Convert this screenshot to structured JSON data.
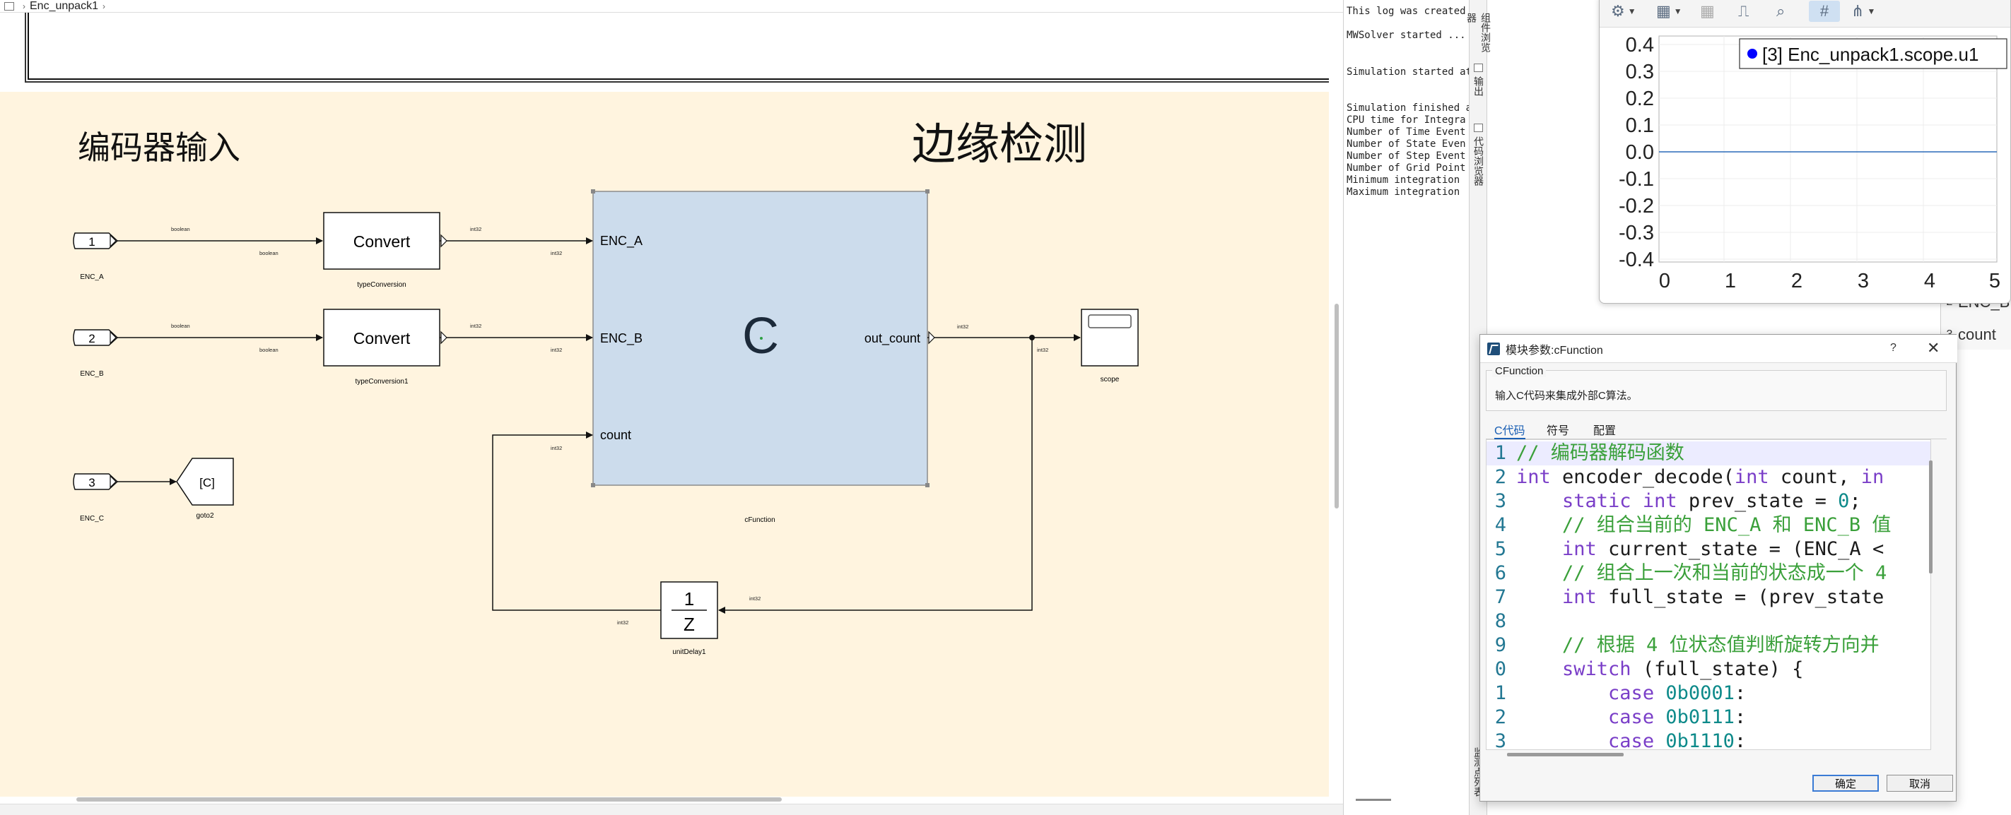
{
  "breadcrumb": {
    "model": "Enc_unpack1"
  },
  "diagram": {
    "areas": {
      "input_title": "编码器输入",
      "edge_title": "边缘检测"
    },
    "inports": [
      {
        "number": "1",
        "name": "ENC_A"
      },
      {
        "number": "2",
        "name": "ENC_B"
      },
      {
        "number": "3",
        "name": "ENC_C"
      }
    ],
    "converts": [
      {
        "label": "Convert",
        "name": "typeConversion"
      },
      {
        "label": "Convert",
        "name": "typeConversion1"
      }
    ],
    "goto": {
      "tag": "[C]",
      "name": "goto2"
    },
    "cfunction": {
      "symbol": "C",
      "name": "cFunction",
      "ports_in": [
        "ENC_A",
        "ENC_B",
        "count"
      ],
      "port_out": "out_count"
    },
    "scope": {
      "name": "scope"
    },
    "delay": {
      "numerator": "1",
      "denominator": "Z",
      "name": "unitDelay1"
    },
    "signal_types": {
      "bool": "boolean",
      "int": "int32"
    }
  },
  "log": {
    "lines": [
      "This log was created b",
      "MWSolver started ...",
      "Simulation started at",
      "Simulation finished at",
      "  CPU time for Integra",
      "  Number of Time Event",
      "  Number of State Even",
      "  Number of Step Event",
      "  Number of Grid Point",
      "  Minimum integration",
      "  Maximum integration"
    ]
  },
  "side_tabs": [
    "组件浏览器",
    "输出",
    "代码浏览器",
    "监测点列表"
  ],
  "scope_window": {
    "legend": "[3] Enc_unpack1.scope.u1",
    "legend_color": "#0000ff",
    "series_color": "#2a6ab8",
    "y_ticks": [
      "0.4",
      "0.3",
      "0.2",
      "0.1",
      "0.0",
      "-0.1",
      "-0.2",
      "-0.3",
      "-0.4"
    ],
    "x_ticks": [
      "0",
      "1",
      "2",
      "3",
      "4",
      "5"
    ]
  },
  "right_strip": {
    "rows": [
      {
        "num": "2",
        "text": "ENC_B"
      },
      {
        "num": "3",
        "text": "count"
      }
    ]
  },
  "dialog": {
    "title": "模块参数:cFunction",
    "help": "?",
    "close": "✕",
    "group_label": "CFunction",
    "group_desc": "输入C代码来集成外部C算法。",
    "tabs": [
      "C代码",
      "符号",
      "配置"
    ],
    "code": [
      {
        "n": "1",
        "tokens": [
          {
            "t": "cm",
            "v": "// 编码器解码函数"
          }
        ]
      },
      {
        "n": "2",
        "tokens": [
          {
            "t": "kw",
            "v": "int"
          },
          {
            "t": "tx",
            "v": " encoder_decode("
          },
          {
            "t": "kw",
            "v": "int"
          },
          {
            "t": "tx",
            "v": " count, "
          },
          {
            "t": "kw",
            "v": "in"
          }
        ]
      },
      {
        "n": "3",
        "tokens": [
          {
            "t": "tx",
            "v": "    "
          },
          {
            "t": "kw",
            "v": "static int"
          },
          {
            "t": "tx",
            "v": " prev_state = "
          },
          {
            "t": "nm",
            "v": "0"
          },
          {
            "t": "tx",
            "v": ";"
          }
        ]
      },
      {
        "n": "4",
        "tokens": [
          {
            "t": "tx",
            "v": "    "
          },
          {
            "t": "cm",
            "v": "// 组合当前的 ENC_A 和 ENC_B 值"
          }
        ]
      },
      {
        "n": "5",
        "tokens": [
          {
            "t": "tx",
            "v": "    "
          },
          {
            "t": "kw",
            "v": "int"
          },
          {
            "t": "tx",
            "v": " current_state = (ENC_A <"
          }
        ]
      },
      {
        "n": "6",
        "tokens": [
          {
            "t": "tx",
            "v": "    "
          },
          {
            "t": "cm",
            "v": "// 组合上一次和当前的状态成一个 4"
          }
        ]
      },
      {
        "n": "7",
        "tokens": [
          {
            "t": "tx",
            "v": "    "
          },
          {
            "t": "kw",
            "v": "int"
          },
          {
            "t": "tx",
            "v": " full_state = (prev_state"
          }
        ]
      },
      {
        "n": "8",
        "tokens": []
      },
      {
        "n": "9",
        "tokens": [
          {
            "t": "tx",
            "v": "    "
          },
          {
            "t": "cm",
            "v": "// 根据 4 位状态值判断旋转方向并"
          }
        ]
      },
      {
        "n": "0",
        "tokens": [
          {
            "t": "tx",
            "v": "    "
          },
          {
            "t": "kw",
            "v": "switch"
          },
          {
            "t": "tx",
            "v": " (full_state) {"
          }
        ]
      },
      {
        "n": "1",
        "tokens": [
          {
            "t": "tx",
            "v": "        "
          },
          {
            "t": "kw",
            "v": "case"
          },
          {
            "t": "tx",
            "v": " "
          },
          {
            "t": "nm",
            "v": "0b0001"
          },
          {
            "t": "tx",
            "v": ":"
          }
        ]
      },
      {
        "n": "2",
        "tokens": [
          {
            "t": "tx",
            "v": "        "
          },
          {
            "t": "kw",
            "v": "case"
          },
          {
            "t": "tx",
            "v": " "
          },
          {
            "t": "nm",
            "v": "0b0111"
          },
          {
            "t": "tx",
            "v": ":"
          }
        ]
      },
      {
        "n": "3",
        "tokens": [
          {
            "t": "tx",
            "v": "        "
          },
          {
            "t": "kw",
            "v": "case"
          },
          {
            "t": "tx",
            "v": " "
          },
          {
            "t": "nm",
            "v": "0b1110"
          },
          {
            "t": "tx",
            "v": ":"
          }
        ]
      }
    ],
    "ok": "确定",
    "cancel": "取消"
  }
}
